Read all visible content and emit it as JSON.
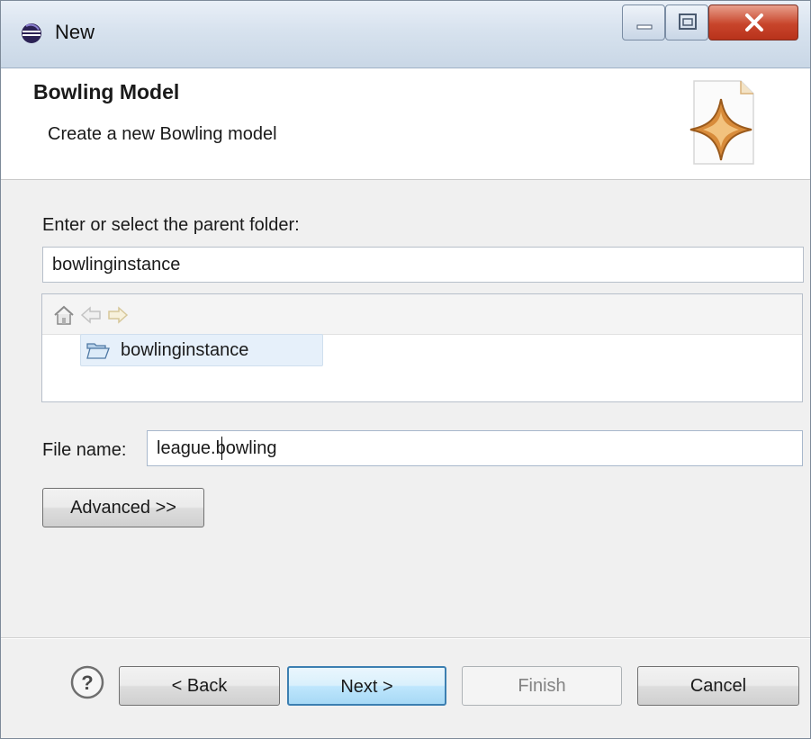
{
  "window": {
    "title": "New",
    "icon": "eclipse-icon"
  },
  "banner": {
    "title": "Bowling Model",
    "description": "Create a new Bowling model",
    "image_icon": "new-model-wizard-icon"
  },
  "parent_folder": {
    "label": "Enter or select the parent folder:",
    "value": "bowlinginstance",
    "toolbar_icons": [
      "home-icon",
      "back-arrow-icon",
      "forward-arrow-icon"
    ],
    "tree_items": [
      {
        "label": "bowlinginstance",
        "icon": "open-folder-icon",
        "selected": true
      }
    ]
  },
  "file_name": {
    "label": "File name:",
    "value": "league.bowling"
  },
  "advanced_button": "Advanced >>",
  "footer": {
    "help_icon": "help-icon",
    "back": "< Back",
    "next": "Next >",
    "finish": "Finish",
    "cancel": "Cancel"
  }
}
